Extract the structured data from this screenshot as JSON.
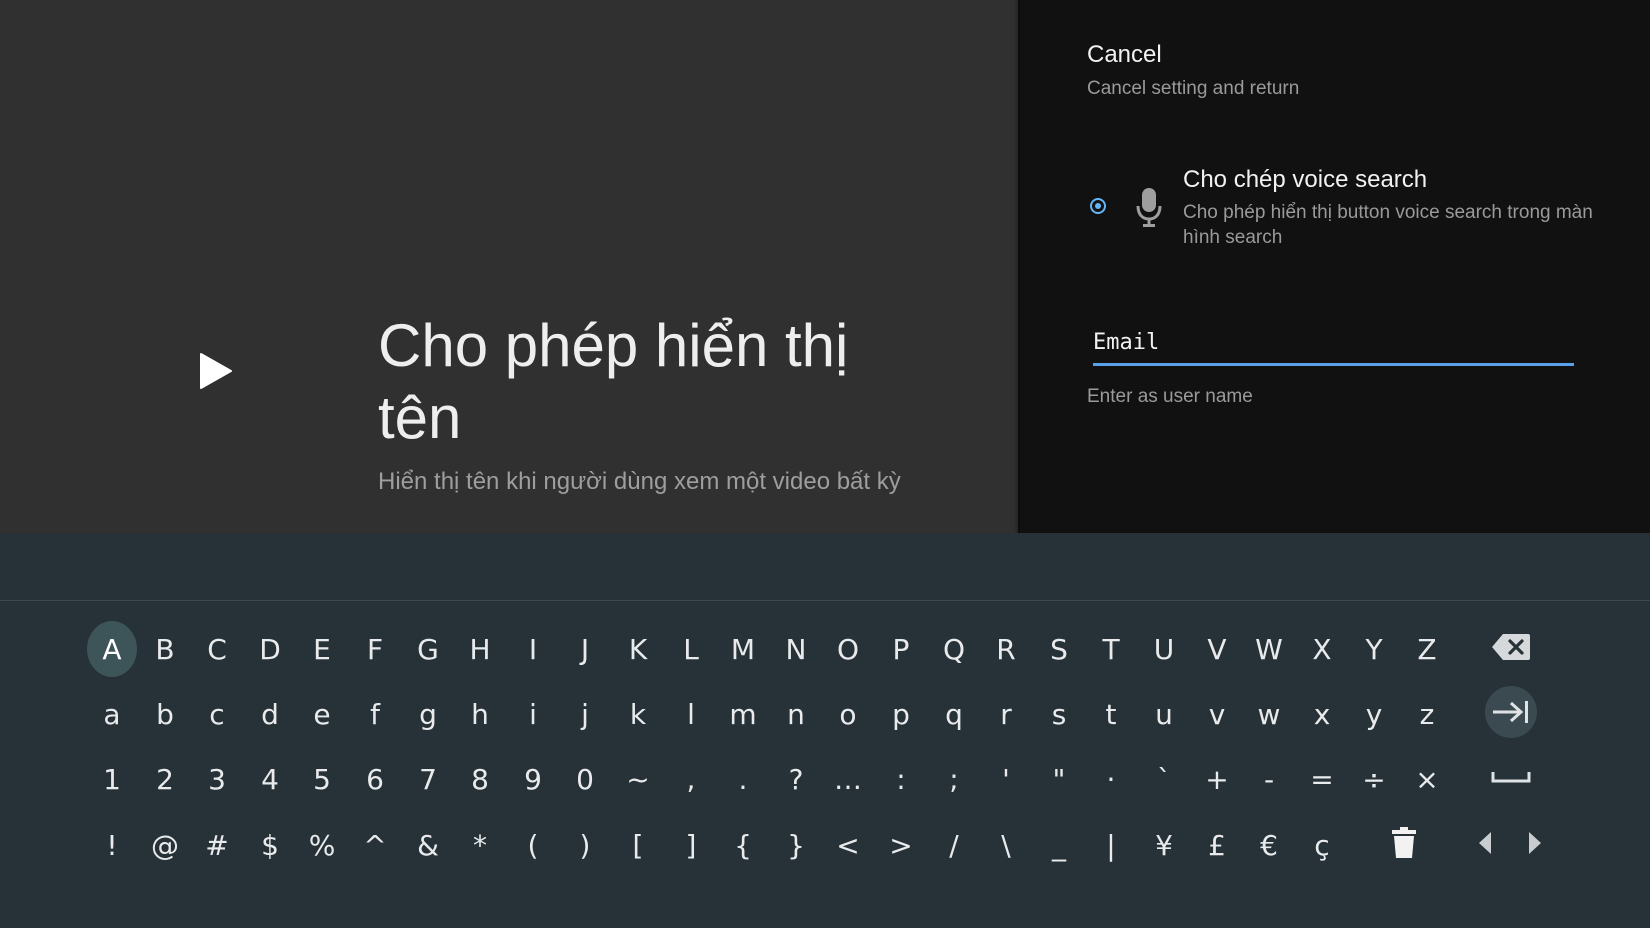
{
  "guide": {
    "title": "Cho phép hiển thị tên",
    "description": "Hiển thị tên khi người dùng xem một video bất kỳ",
    "icon": "play-arrow-icon"
  },
  "actions": {
    "cancel": {
      "title": "Cancel",
      "description": "Cancel setting and return"
    },
    "voice_search": {
      "title": "Cho chép voice search",
      "description": "Cho phép hiển thị button voice search trong màn hình search",
      "icon": "microphone-icon",
      "selected": true
    },
    "email": {
      "value": "Email",
      "hint": "Enter as user name"
    }
  },
  "colors": {
    "accent": "#5aa0e8",
    "guide_bg": "#303030",
    "actions_bg": "#111111",
    "keyboard_bg": "#263238",
    "focused_key_bg": "#3d5458"
  },
  "keyboard": {
    "focused_key": "A",
    "rows": [
      [
        "A",
        "B",
        "C",
        "D",
        "E",
        "F",
        "G",
        "H",
        "I",
        "J",
        "K",
        "L",
        "M",
        "N",
        "O",
        "P",
        "Q",
        "R",
        "S",
        "T",
        "U",
        "V",
        "W",
        "X",
        "Y",
        "Z"
      ],
      [
        "a",
        "b",
        "c",
        "d",
        "e",
        "f",
        "g",
        "h",
        "i",
        "j",
        "k",
        "l",
        "m",
        "n",
        "o",
        "p",
        "q",
        "r",
        "s",
        "t",
        "u",
        "v",
        "w",
        "x",
        "y",
        "z"
      ],
      [
        "1",
        "2",
        "3",
        "4",
        "5",
        "6",
        "7",
        "8",
        "9",
        "0",
        "~",
        ",",
        ".",
        "?",
        "…",
        ":",
        ";",
        "'",
        "\"",
        "·",
        "`",
        "+",
        "-",
        "=",
        "÷",
        "×"
      ],
      [
        "!",
        "@",
        "#",
        "$",
        "%",
        "^",
        "&",
        "*",
        "(",
        ")",
        "[",
        "]",
        "{",
        "}",
        "<",
        ">",
        "/",
        "\\",
        "_",
        "|",
        "¥",
        "£",
        "€",
        "ç"
      ]
    ],
    "function_keys": {
      "row1": "backspace-icon",
      "row2": "tab-icon",
      "row3": "space-icon",
      "row4_delete": "delete-icon",
      "row4_left": "arrow-left-icon",
      "row4_right": "arrow-right-icon"
    }
  }
}
